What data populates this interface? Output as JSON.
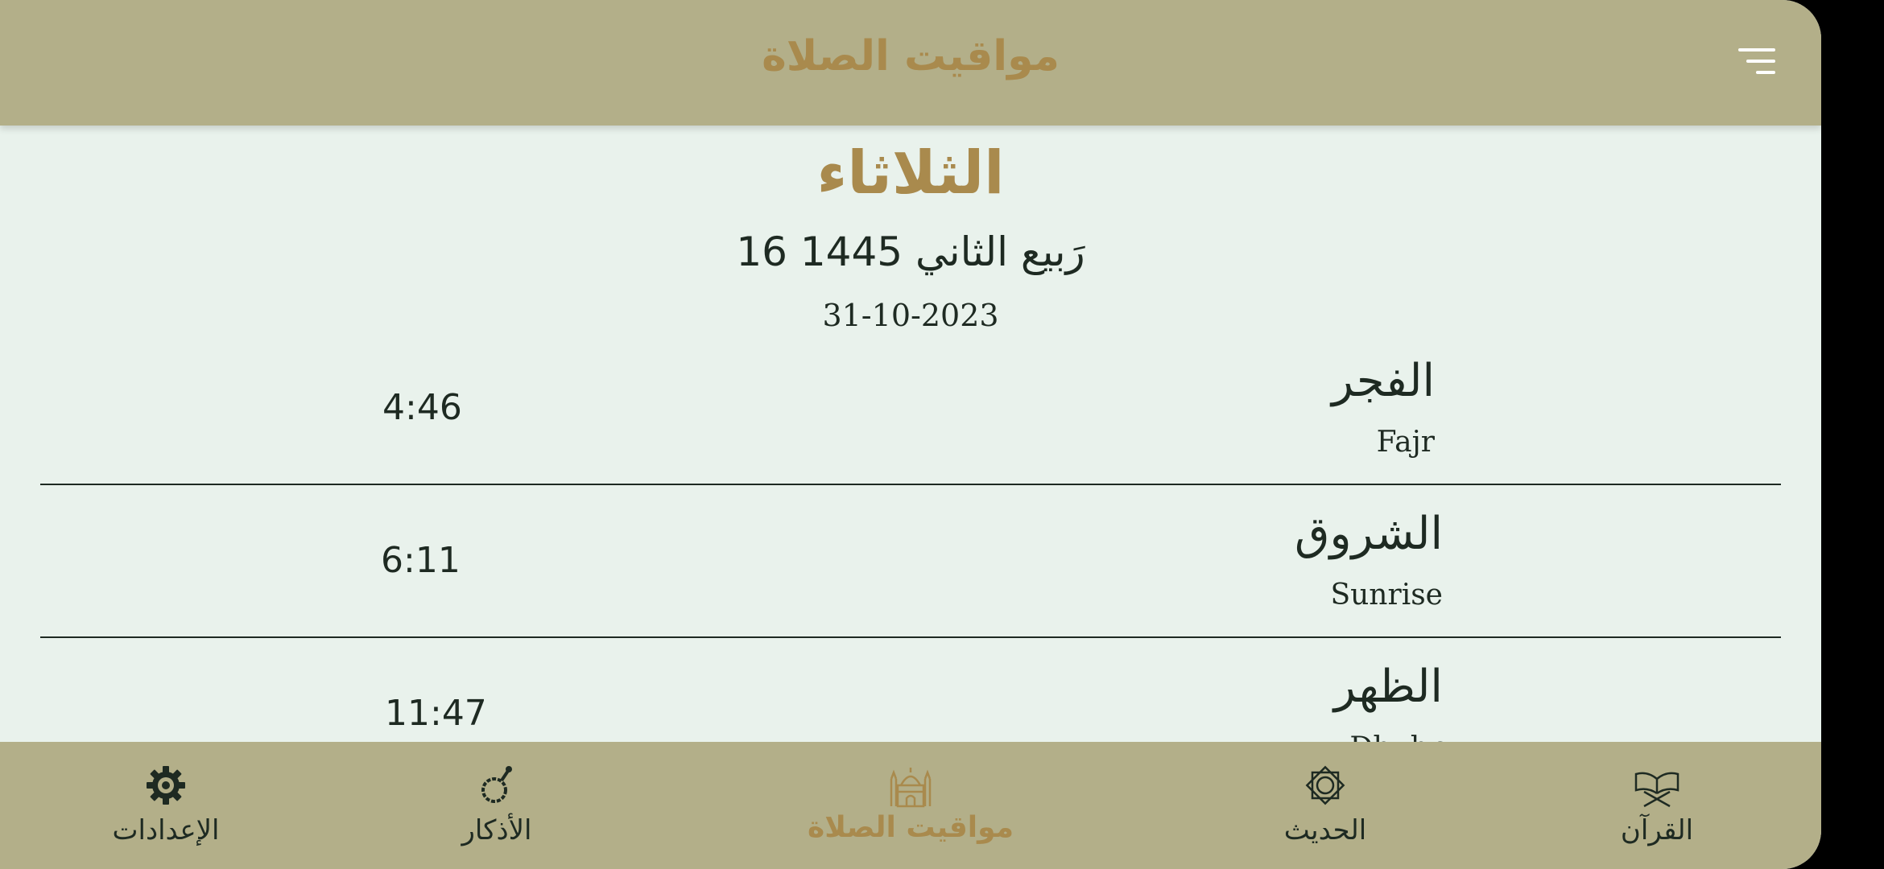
{
  "header": {
    "title": "مواقيت الصلاة"
  },
  "date": {
    "day": "الثلاثاء",
    "hijri": "16 رَبيع الثاني 1445",
    "gregorian": "31-10-2023"
  },
  "prayers": [
    {
      "arabic": "الفجر",
      "english": "Fajr",
      "time": "4:46"
    },
    {
      "arabic": "الشروق",
      "english": "Sunrise",
      "time": "6:11"
    },
    {
      "arabic": "الظهر",
      "english": "Dhuhr",
      "time": "11:47"
    }
  ],
  "bottom_nav": {
    "settings": "الإعدادات",
    "adhkar": "الأذكار",
    "prayer_times": "مواقيت الصلاة",
    "hadith": "الحديث",
    "quran": "القرآن"
  },
  "colors": {
    "bar": "#b3af89",
    "accent": "#a98a4d",
    "background": "#e9f2ec",
    "text": "#1e2a22"
  },
  "icons": [
    "menu-icon",
    "gear-icon",
    "prayer-beads-icon",
    "mosque-icon",
    "star-icon",
    "quran-book-icon"
  ]
}
